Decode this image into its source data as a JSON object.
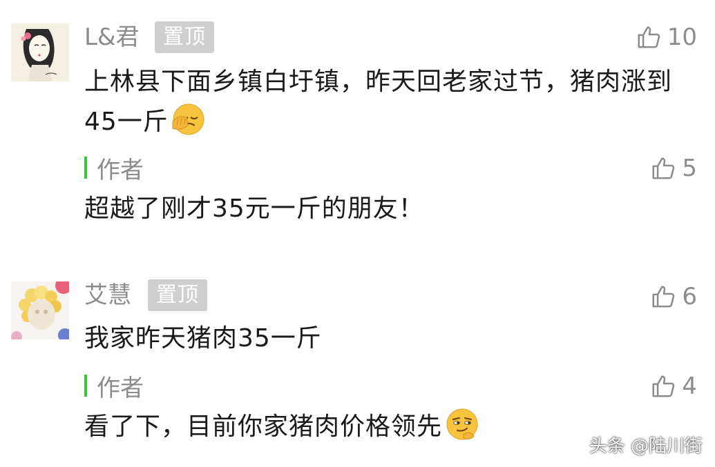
{
  "comments": [
    {
      "username": "L&君",
      "pin_label": "置顶",
      "like_count": "10",
      "text": "上林县下面乡镇白圩镇，昨天回老家过节，猪肉涨到45一斤",
      "emoji_icon": "facepalm-emoji-icon",
      "reply": {
        "author_label": "作者",
        "like_count": "5",
        "text": "超越了刚才35元一斤的朋友！"
      }
    },
    {
      "username": "艾慧",
      "pin_label": "置顶",
      "like_count": "6",
      "text": "我家昨天猪肉35一斤",
      "reply": {
        "author_label": "作者",
        "like_count": "4",
        "text": "看了下，目前你家猪肉价格领先",
        "emoji_icon": "smirk-emoji-icon"
      }
    }
  ],
  "watermark": "头条 @陆川街",
  "colors": {
    "author_bar": "#3fbf3f",
    "muted_text": "#8c8c8c",
    "pin_badge_bg": "#cfcfcf"
  }
}
